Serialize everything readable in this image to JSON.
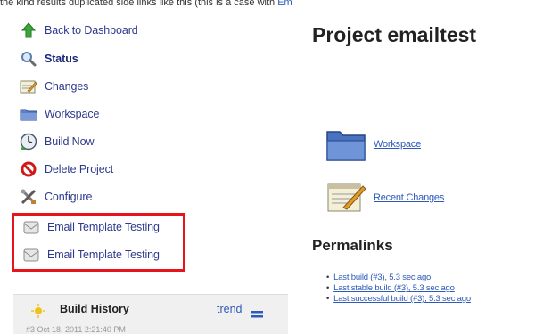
{
  "top_fragment": {
    "text": "the kind results duplicated side links like this (this is a case with",
    "link": "Em"
  },
  "sidebar": {
    "items": [
      {
        "label": "Back to Dashboard",
        "icon": "up-arrow-icon"
      },
      {
        "label": "Status",
        "icon": "search-icon"
      },
      {
        "label": "Changes",
        "icon": "notepad-icon"
      },
      {
        "label": "Workspace",
        "icon": "folder-icon"
      },
      {
        "label": "Build Now",
        "icon": "clock-play-icon"
      },
      {
        "label": "Delete Project",
        "icon": "no-entry-icon"
      },
      {
        "label": "Configure",
        "icon": "tools-icon"
      },
      {
        "label": "Email Template Testing",
        "icon": "envelope-icon"
      },
      {
        "label": "Email Template Testing",
        "icon": "envelope-icon"
      }
    ],
    "highlight_color": "#e8141c"
  },
  "build_history": {
    "title": "Build History",
    "trend_label": "trend",
    "row_text": "#3  Oct 18, 2011 2:21:40 PM"
  },
  "main": {
    "title": "Project emailtest",
    "links": [
      {
        "label": "Workspace",
        "icon": "folder-icon"
      },
      {
        "label": "Recent Changes",
        "icon": "notepad-icon"
      }
    ],
    "permalinks_title": "Permalinks",
    "permalinks": [
      "Last build (#3), 5.3 sec ago",
      "Last stable build (#3), 5.3 sec ago",
      "Last successful build (#3), 5.3 sec ago"
    ]
  }
}
